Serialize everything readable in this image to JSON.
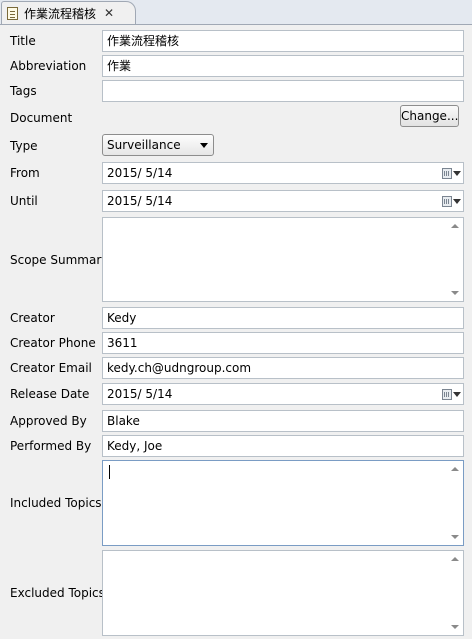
{
  "tab": {
    "title": "作業流程稽核",
    "close": "✕",
    "icon": "document-icon"
  },
  "labels": {
    "title": "Title",
    "abbreviation": "Abbreviation",
    "tags": "Tags",
    "document": "Document",
    "type": "Type",
    "from": "From",
    "until": "Until",
    "scope_summary": "Scope Summary",
    "creator": "Creator",
    "creator_phone": "Creator Phone",
    "creator_email": "Creator Email",
    "release_date": "Release Date",
    "approved_by": "Approved By",
    "performed_by": "Performed By",
    "included_topics": "Included Topics",
    "excluded_topics": "Excluded Topics"
  },
  "values": {
    "title": "作業流程稽核",
    "abbreviation": "作業",
    "tags": "",
    "type": "Surveillance",
    "from": "2015/  5/14",
    "until": "2015/  5/14",
    "scope_summary": "",
    "creator": "Kedy",
    "creator_phone": "3611",
    "creator_email": "kedy.ch@udngroup.com",
    "release_date": "2015/  5/14",
    "approved_by": "Blake",
    "performed_by": "Kedy, Joe",
    "included_topics": "",
    "excluded_topics": ""
  },
  "buttons": {
    "change": "Change..."
  }
}
